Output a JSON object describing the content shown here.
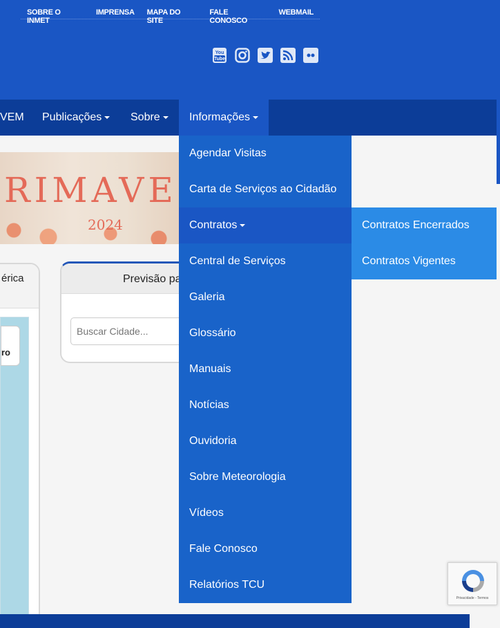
{
  "top_links": [
    "SOBRE O INMET",
    "IMPRENSA",
    "MAPA DO SITE",
    "FALE CONOSCO",
    "WEBMAIL"
  ],
  "social_icons": [
    "youtube-icon",
    "instagram-icon",
    "twitter-icon",
    "rss-icon",
    "flickr-icon"
  ],
  "nav": {
    "item_partial": "VEM",
    "publicacoes": "Publicações",
    "sobre": "Sobre",
    "informacoes": "Informações"
  },
  "banner": {
    "word": "RIMAVE",
    "year": "2024"
  },
  "card1": {
    "title": "érica",
    "badge": "ro"
  },
  "card2": {
    "title": "Previsão pa",
    "search_placeholder": "Buscar Cidade..."
  },
  "dropdown": {
    "items": [
      "Agendar Visitas",
      "Carta de Serviços ao Cidadão",
      "Contratos",
      "Central de Serviços",
      "Galeria",
      "Glossário",
      "Manuais",
      "Notícias",
      "Ouvidoria",
      "Sobre Meteorologia",
      "Vídeos",
      "Fale Conosco",
      "Relatórios TCU"
    ]
  },
  "submenu": {
    "items": [
      "Contratos Encerrados",
      "Contratos Vigentes"
    ]
  },
  "recaptcha": {
    "text": "Privacidade - Termos"
  },
  "colors": {
    "header_blue": "#1a56c4",
    "nav_blue": "#0c3d98",
    "dropdown_blue": "#1963c9",
    "submenu_blue": "#2b8be6"
  }
}
